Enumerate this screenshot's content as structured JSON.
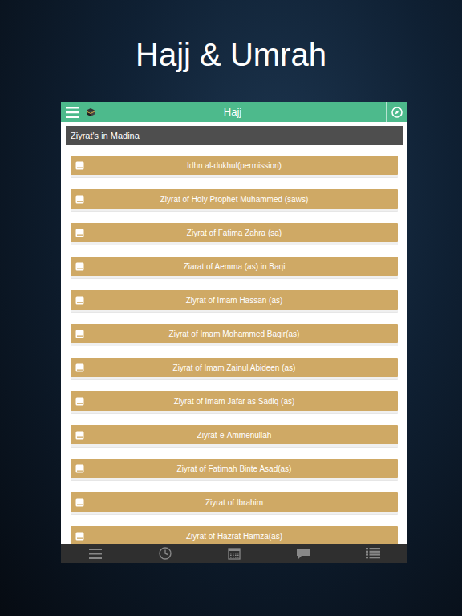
{
  "screen": {
    "title": "Hajj & Umrah"
  },
  "header": {
    "title": "Hajj"
  },
  "section": {
    "title": "Ziyrat's in Madina"
  },
  "items": [
    {
      "label": "Idhn al-dukhul(permission)"
    },
    {
      "label": "Ziyrat of Holy Prophet Muhammed (saws)"
    },
    {
      "label": "Ziyrat of Fatima Zahra (sa)"
    },
    {
      "label": "Ziarat of Aemma (as) in Baqi"
    },
    {
      "label": "Ziyrat of Imam Hassan (as)"
    },
    {
      "label": "Ziyrat of Imam Mohammed Baqir(as)"
    },
    {
      "label": "Ziyrat of Imam Zainul Abideen (as)"
    },
    {
      "label": "Ziyrat of Imam Jafar as Sadiq (as)"
    },
    {
      "label": "Ziyrat-e-Ammenullah"
    },
    {
      "label": "Ziyrat of Fatimah Binte Asad(as)"
    },
    {
      "label": "Ziyrat of Ibrahim"
    },
    {
      "label": "Ziyrat of Hazrat Hamza(as)"
    }
  ],
  "tab_bar": [
    {
      "kind": "menu"
    },
    {
      "kind": "clock"
    },
    {
      "kind": "calendar"
    },
    {
      "kind": "chat"
    },
    {
      "kind": "list"
    }
  ]
}
